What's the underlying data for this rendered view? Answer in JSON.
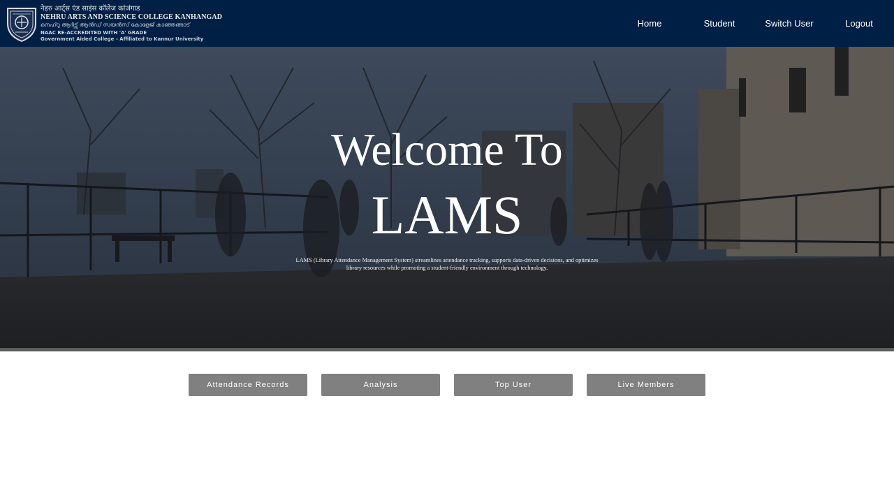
{
  "header": {
    "brand": {
      "hindi_name": "नेहरु आर्ट्स एंड साइंस कॉलेज कांजंगाड",
      "english_name": "NEHRU ARTS AND SCIENCE COLLEGE KANHANGAD",
      "malayalam_name": "നെഹ്റു ആർട്സ് ആൻഡ് സയൻസ് കോളേജ് കാഞ്ഞങ്ങാട്",
      "accreditation": "NAAC RE-ACCREDITED WITH 'A' GRADE",
      "affiliation": "Government Aided College - Affiliated to Kannur University",
      "logo_icon": "college-crest-icon"
    },
    "nav": [
      {
        "label": "Home"
      },
      {
        "label": "Student"
      },
      {
        "label": "Switch User"
      },
      {
        "label": "Logout"
      }
    ]
  },
  "hero": {
    "title": "Welcome To",
    "subtitle": "LAMS",
    "description": "LAMS (Library Attendance Management System) streamlines attendance tracking, supports data-driven decisions, and optimizes library resources while promoting a student-friendly environment through technology."
  },
  "actions": [
    {
      "label": "Attendance Records"
    },
    {
      "label": "Analysis"
    },
    {
      "label": "Top User"
    },
    {
      "label": "Live Members"
    }
  ],
  "colors": {
    "navbar_bg": "#001f45",
    "button_bg": "#808080",
    "text_light": "#ffffff"
  }
}
